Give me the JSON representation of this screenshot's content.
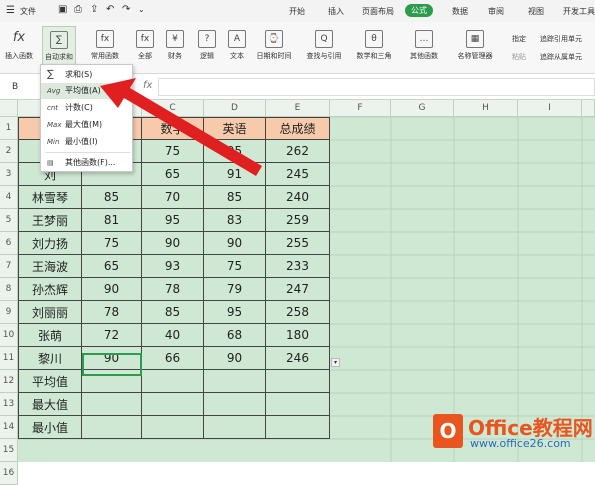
{
  "topbar": {
    "menu": "文件",
    "tabs": [
      "开始",
      "插入",
      "页面布局",
      "公式",
      "数据",
      "审阅",
      "视图",
      "开发工具"
    ],
    "active_tab": "公式"
  },
  "ribbon": {
    "groups": [
      "插入函数",
      "自动求和",
      "常用函数",
      "全部",
      "财务",
      "逻辑",
      "文本",
      "日期和时间",
      "查找与引用",
      "数学和三角",
      "其他函数",
      "名称管理器"
    ],
    "icons": [
      "fx",
      "∑",
      "fx",
      "fx",
      "¥",
      "?",
      "A",
      "⌚",
      "Q",
      "θ",
      "…",
      "▦"
    ],
    "right": {
      "specify": "指定",
      "paste": "粘贴",
      "trace_prec": "追踪引用单元",
      "trace_dep": "追踪从属单元"
    }
  },
  "formula_bar": {
    "name_box": "B",
    "fx": "fx",
    "value": ""
  },
  "autosum_menu": {
    "items": [
      {
        "icon": "∑",
        "label": "求和(S)"
      },
      {
        "icon": "Avg",
        "label": "平均值(A)"
      },
      {
        "icon": "cnt",
        "label": "计数(C)"
      },
      {
        "icon": "Max",
        "label": "最大值(M)"
      },
      {
        "icon": "Min",
        "label": "最小值(I)"
      },
      {
        "icon": "▤",
        "label": "其他函数(F)..."
      }
    ]
  },
  "columns": [
    "C",
    "D",
    "E",
    "F",
    "G",
    "H",
    "I"
  ],
  "rows": [
    "1",
    "2",
    "3",
    "4",
    "5",
    "6",
    "7",
    "8",
    "9",
    "10",
    "11",
    "12",
    "13",
    "14",
    "15",
    "16"
  ],
  "table": {
    "header": [
      "姓",
      "",
      "数学",
      "英语",
      "总成绩"
    ],
    "rows": [
      [
        "张",
        "",
        "75",
        "95",
        "262"
      ],
      [
        "刘",
        "",
        "65",
        "91",
        "245"
      ],
      [
        "林雪琴",
        "85",
        "70",
        "85",
        "240"
      ],
      [
        "王梦丽",
        "81",
        "95",
        "83",
        "259"
      ],
      [
        "刘力扬",
        "75",
        "90",
        "90",
        "255"
      ],
      [
        "王海波",
        "65",
        "93",
        "75",
        "233"
      ],
      [
        "孙杰辉",
        "90",
        "78",
        "79",
        "247"
      ],
      [
        "刘丽丽",
        "78",
        "85",
        "95",
        "258"
      ],
      [
        "张萌",
        "72",
        "40",
        "68",
        "180"
      ],
      [
        "黎川",
        "90",
        "66",
        "90",
        "246"
      ],
      [
        "平均值",
        "",
        "",
        "",
        ""
      ],
      [
        "最大值",
        "",
        "",
        "",
        ""
      ],
      [
        "最小值",
        "",
        "",
        "",
        ""
      ]
    ]
  },
  "watermark": {
    "brand": "Office教程网",
    "url": "www.office26.com"
  },
  "colors": {
    "accent": "#2c9b4e",
    "header_fill": "#f7caac",
    "grid_bg": "#cfe8d3",
    "arrow": "#e02020"
  }
}
